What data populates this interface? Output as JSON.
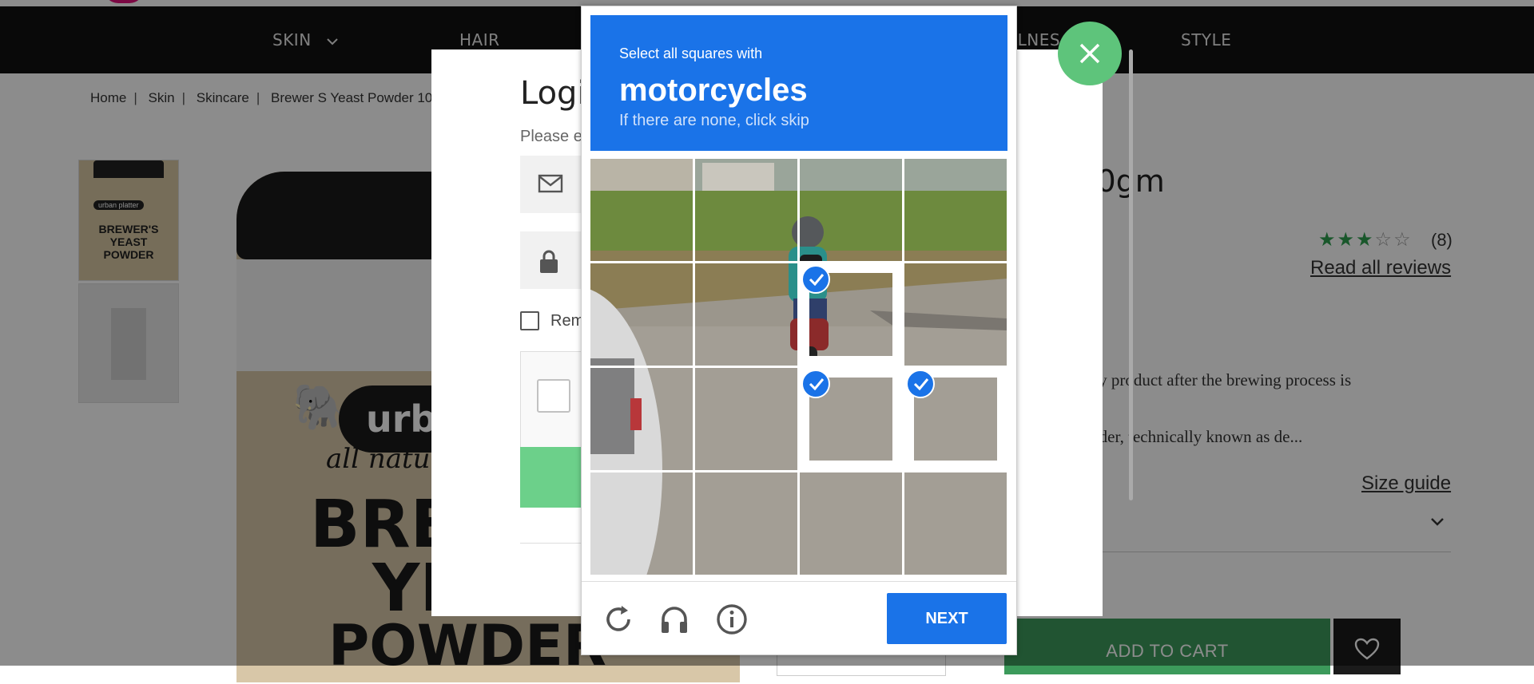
{
  "nav": {
    "items": [
      "SKIN",
      "HAIR",
      "WELLNESS",
      "STYLE"
    ],
    "visible_fragment": "LLNES"
  },
  "breadcrumb": [
    "Home",
    "Skin",
    "Skincare",
    "Brewer S Yeast Powder 10"
  ],
  "product": {
    "title_fragment": ", 100gm",
    "rating_count": "(8)",
    "read_reviews": "Read all reviews",
    "desc_line1": "a by product after the brewing process is",
    "desc_line2": "owder, technically known as de...",
    "size_guide": "Size guide",
    "add_to_cart": "ADD TO CART",
    "jar_brand": "urban",
    "jar_tag": "all natural",
    "jar_lines": [
      "BRE",
      "YE",
      "POWDER"
    ],
    "thumb_text": [
      "urban platter",
      "BREWER'S",
      "YEAST",
      "POWDER"
    ]
  },
  "login": {
    "title": "Logi",
    "subtitle": "Please e",
    "remember": "Rem"
  },
  "captcha": {
    "prompt": "Select all squares with",
    "target": "motorcycles",
    "hint": "If there are none, click skip",
    "next_label": "NEXT",
    "selected_tiles": [
      6,
      10,
      11
    ],
    "icons": [
      "reload-icon",
      "audio-icon",
      "info-icon"
    ]
  },
  "colors": {
    "accent_blue": "#1a73e8",
    "green": "#5ec47b",
    "navbar": "#111111"
  }
}
